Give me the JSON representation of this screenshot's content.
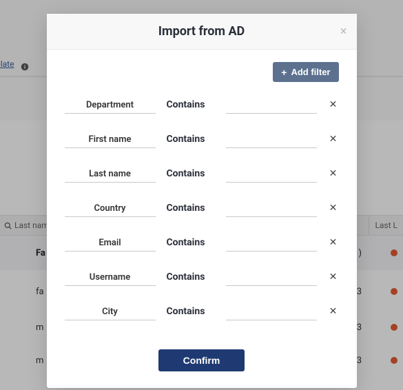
{
  "modal": {
    "title": "Import from AD",
    "close_symbol": "×",
    "add_filter_label": "Add filter",
    "confirm_label": "Confirm",
    "filters": [
      {
        "field": "Department",
        "condition": "Contains",
        "value": ""
      },
      {
        "field": "First name",
        "condition": "Contains",
        "value": ""
      },
      {
        "field": "Last name",
        "condition": "Contains",
        "value": ""
      },
      {
        "field": "Country",
        "condition": "Contains",
        "value": ""
      },
      {
        "field": "Email",
        "condition": "Contains",
        "value": ""
      },
      {
        "field": "Username",
        "condition": "Contains",
        "value": ""
      },
      {
        "field": "City",
        "condition": "Contains",
        "value": ""
      }
    ]
  },
  "background": {
    "template_link": "plate",
    "table": {
      "col_lastname": "Last name",
      "col_lastlogin": "Last L"
    },
    "rows": {
      "r0": "Fa",
      "r1": "fa",
      "r2": "m",
      "r3": "m"
    }
  }
}
